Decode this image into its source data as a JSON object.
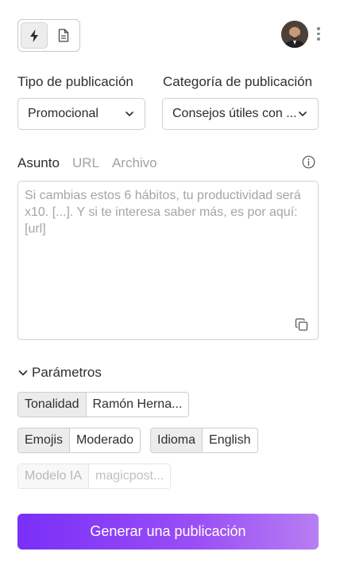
{
  "header": {
    "modes": [
      {
        "icon": "lightning-icon",
        "active": true
      },
      {
        "icon": "document-icon",
        "active": false
      }
    ],
    "avatar_icon": "user-avatar",
    "more_icon": "more-vertical-icon"
  },
  "form": {
    "type": {
      "label": "Tipo de publicación",
      "value": "Promocional"
    },
    "category": {
      "label": "Categoría de publicación",
      "value": "Consejos útiles con ..."
    }
  },
  "source_tabs": {
    "items": [
      "Asunto",
      "URL",
      "Archivo"
    ],
    "active": "Asunto",
    "info_icon": "info-icon"
  },
  "subject": {
    "value": "",
    "placeholder": "Si cambias estos 6 hábitos, tu productividad será x10. [...]. Y si te interesa saber más, es por aquí: [url]",
    "copy_icon": "copy-icon"
  },
  "params": {
    "toggle_label": "Parámetros",
    "expanded": true,
    "tonality": {
      "key": "Tonalidad",
      "value": "Ramón Herna..."
    },
    "emojis": {
      "key": "Emojis",
      "value": "Moderado"
    },
    "language": {
      "key": "Idioma",
      "value": "English"
    },
    "model": {
      "key": "Modelo IA",
      "value": "magicpost...",
      "disabled": true
    }
  },
  "generate_button": {
    "label": "Generar una publicación"
  },
  "colors": {
    "accent_start": "#7a2ff7",
    "accent_end": "#b77ef2",
    "border": "#cfcfcf",
    "muted_text": "#a2a2a2"
  }
}
